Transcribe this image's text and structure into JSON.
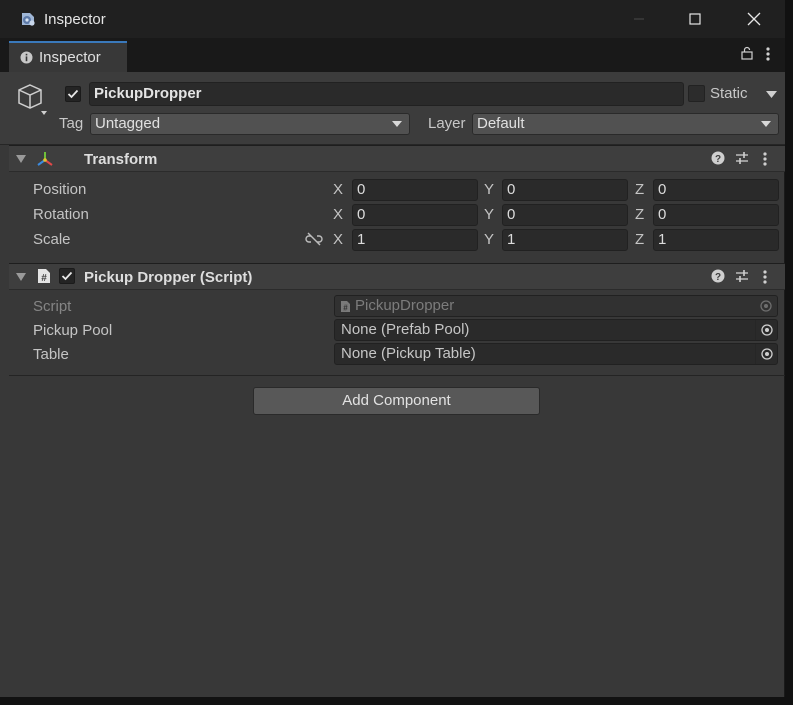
{
  "window": {
    "title": "Inspector",
    "icon": "unity-cog-icon"
  },
  "tab": {
    "label": "Inspector",
    "icon": "info-icon"
  },
  "header": {
    "object_name": "PickupDropper",
    "active": true,
    "static_label": "Static",
    "static_checked": false,
    "tag_label": "Tag",
    "tag_value": "Untagged",
    "layer_label": "Layer",
    "layer_value": "Default"
  },
  "transform": {
    "title": "Transform",
    "rows": [
      {
        "label": "Position",
        "x": "0",
        "y": "0",
        "z": "0"
      },
      {
        "label": "Rotation",
        "x": "0",
        "y": "0",
        "z": "0"
      },
      {
        "label": "Scale",
        "x": "1",
        "y": "1",
        "z": "1"
      }
    ],
    "axis_labels": {
      "x": "X",
      "y": "Y",
      "z": "Z"
    }
  },
  "script_component": {
    "title": "Pickup Dropper (Script)",
    "enabled": true,
    "fields": [
      {
        "label": "Script",
        "value": "PickupDropper"
      },
      {
        "label": "Pickup Pool",
        "value": "None (Prefab Pool)"
      },
      {
        "label": "Table",
        "value": "None (Pickup Table)"
      }
    ]
  },
  "add_component_label": "Add Component",
  "colors": {
    "accent": "#3a79bb",
    "panel": "#383838",
    "titlebar": "#202020"
  }
}
